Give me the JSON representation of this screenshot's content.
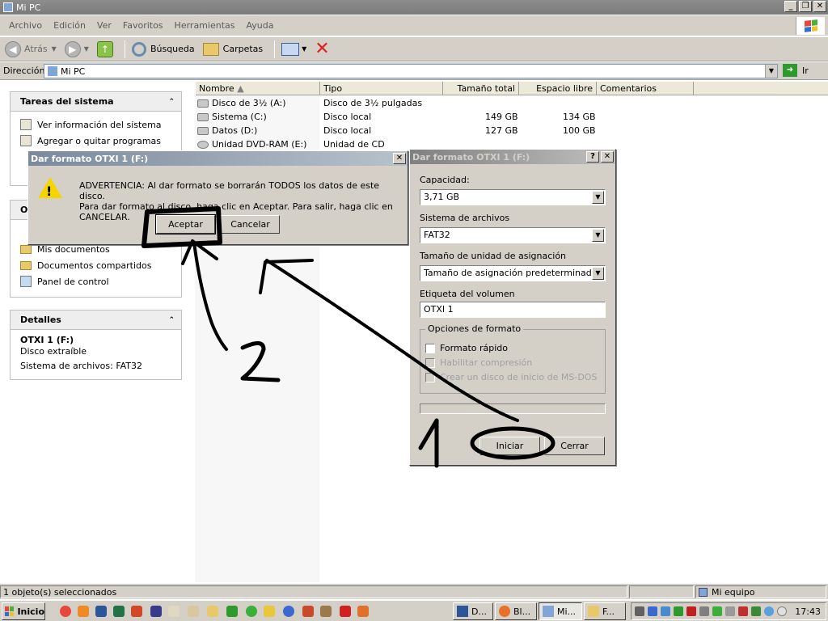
{
  "window": {
    "title": "Mi PC"
  },
  "menu": [
    "Archivo",
    "Edición",
    "Ver",
    "Favoritos",
    "Herramientas",
    "Ayuda"
  ],
  "toolbar": {
    "back": "Atrás",
    "search": "Búsqueda",
    "folders": "Carpetas"
  },
  "address": {
    "label": "Dirección",
    "value": "Mi PC",
    "go": "Ir"
  },
  "tasks": {
    "title": "Tareas del sistema",
    "items": [
      "Ver información del sistema",
      "Agregar o quitar programas"
    ]
  },
  "other_places": {
    "title_fragment": "O",
    "items": [
      "Mis documentos",
      "Documentos compartidos",
      "Panel de control"
    ]
  },
  "details": {
    "title": "Detalles",
    "name": "OTXI 1 (F:)",
    "type": "Disco extraíble",
    "fs": "Sistema de archivos: FAT32"
  },
  "columns": [
    "Nombre",
    "Tipo",
    "Tamaño total",
    "Espacio libre",
    "Comentarios"
  ],
  "drives": [
    {
      "name": "Disco de 3½ (A:)",
      "type": "Disco de 3½ pulgadas",
      "total": "",
      "free": ""
    },
    {
      "name": "Sistema (C:)",
      "type": "Disco local",
      "total": "149 GB",
      "free": "134 GB"
    },
    {
      "name": "Datos (D:)",
      "type": "Disco local",
      "total": "127 GB",
      "free": "100 GB"
    },
    {
      "name": "Unidad DVD-RAM (E:)",
      "type": "Unidad de CD",
      "total": "",
      "free": ""
    }
  ],
  "confirm_dialog": {
    "title": "Dar formato OTXI 1 (F:)",
    "line1": "ADVERTENCIA: Al dar formato se borrarán TODOS los datos de este disco.",
    "line2": "Para dar formato al disco, haga clic en Aceptar. Para salir, haga clic en CANCELAR.",
    "ok": "Aceptar",
    "cancel": "Cancelar"
  },
  "format_dialog": {
    "title": "Dar formato OTXI 1 (F:)",
    "help": "?",
    "capacity_label": "Capacidad:",
    "capacity": "3,71 GB",
    "fs_label": "Sistema de archivos",
    "fs": "FAT32",
    "alloc_label": "Tamaño de unidad de asignación",
    "alloc": "Tamaño de asignación predeterminado",
    "volume_label": "Etiqueta del volumen",
    "volume": "OTXI 1",
    "options_label": "Opciones de formato",
    "quick": "Formato rápido",
    "compress": "Habilitar compresión",
    "msdos": "Crear un disco de inicio de MS-DOS",
    "start": "Iniciar",
    "close": "Cerrar"
  },
  "status": {
    "selected": "1 objeto(s) seleccionados",
    "location": "Mi equipo"
  },
  "taskbar": {
    "start": "Inicio",
    "buttons": [
      "D...",
      "Bl...",
      "Mi...",
      "F..."
    ],
    "clock": "17:43"
  },
  "annotations": {
    "n1": "1",
    "n2": "2"
  },
  "colors": {
    "warning": "#f5d400",
    "go_green": "#2e9a2e",
    "folder": "#e8c869"
  }
}
